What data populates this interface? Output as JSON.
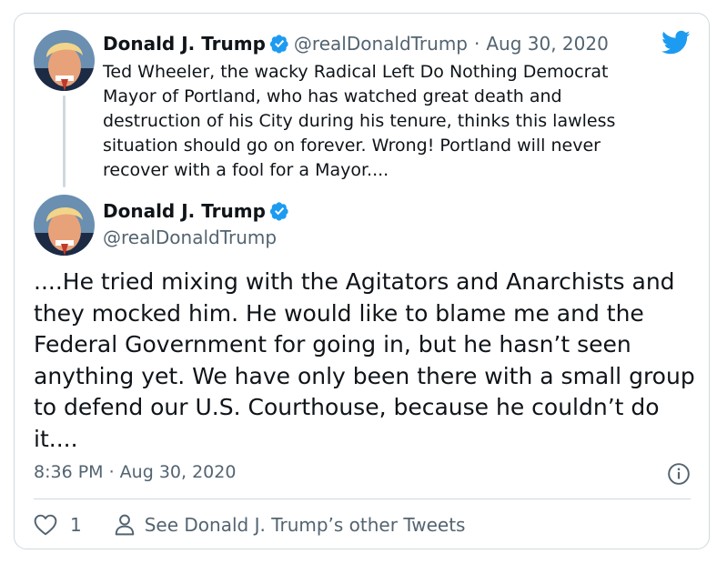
{
  "colors": {
    "accent": "#1d9bf0",
    "text": "#0f1419",
    "muted": "#536471",
    "border": "#cfd9de"
  },
  "icons": {
    "brand": "twitter-bird-icon",
    "verified": "verified-badge-icon",
    "info": "info-icon",
    "like": "heart-icon",
    "profile": "person-icon"
  },
  "quoted_tweet": {
    "author_name": "Donald J. Trump",
    "handle": "@realDonaldTrump",
    "separator": "·",
    "date": "Aug 30, 2020",
    "text": "Ted Wheeler, the wacky Radical Left Do Nothing Democrat Mayor of Portland, who has watched great death and destruction of his City during his tenure, thinks this lawless situation should go on forever. Wrong! Portland will never recover with a fool for a Mayor...."
  },
  "tweet": {
    "author_name": "Donald J. Trump",
    "handle": "@realDonaldTrump",
    "text": "....He tried mixing with the Agitators and Anarchists and they mocked him. He would like to blame me and the Federal Government for going in, but he hasn’t seen anything yet. We have only been there with a small group to defend our U.S. Courthouse, because he couldn’t do it....",
    "timestamp": "8:36 PM · Aug 30, 2020"
  },
  "actions": {
    "like_count": "1",
    "other_tweets_label": "See Donald J. Trump’s other Tweets"
  }
}
